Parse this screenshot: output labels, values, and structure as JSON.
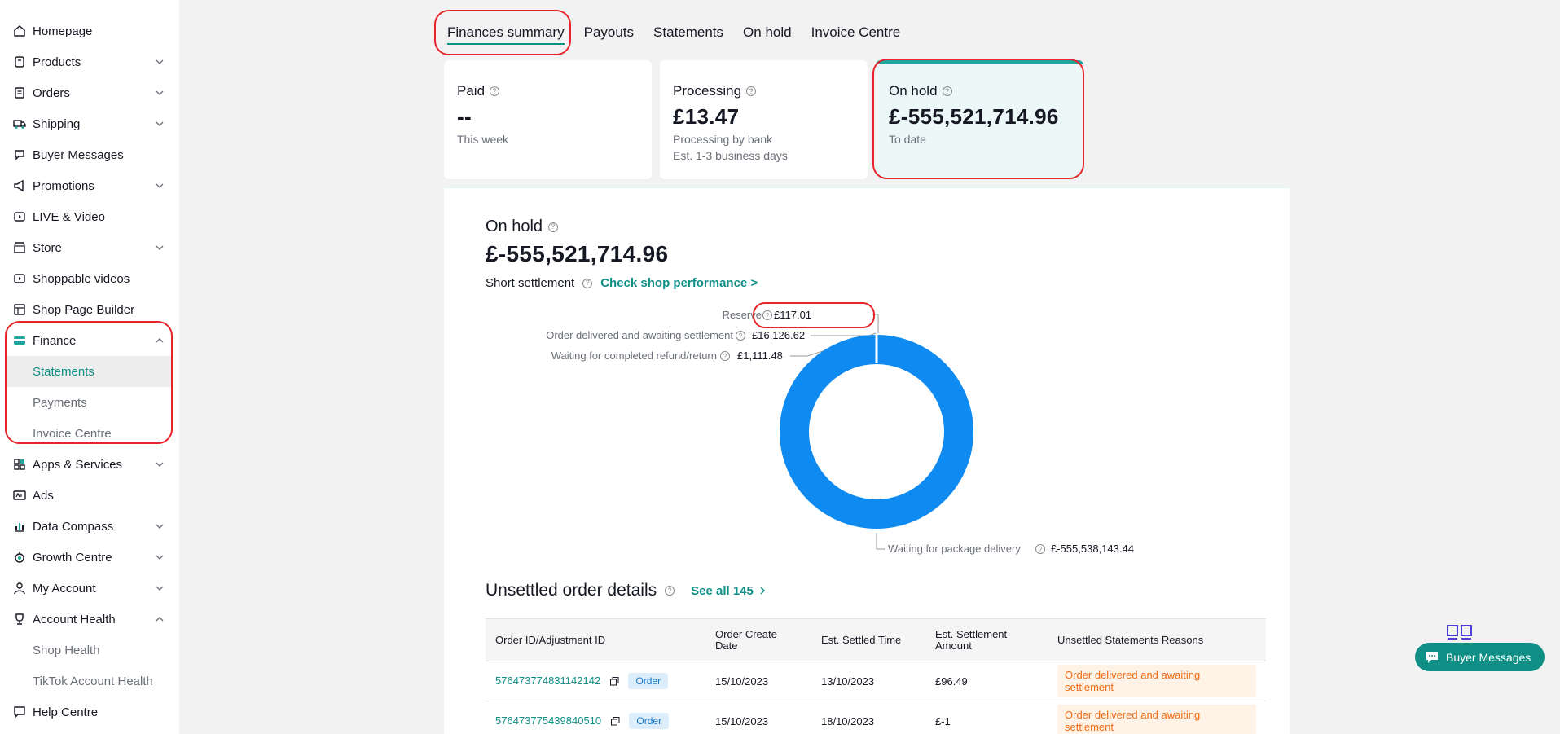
{
  "sidebar": {
    "items": [
      {
        "label": "Homepage",
        "icon": "home-icon",
        "chevron": false
      },
      {
        "label": "Products",
        "icon": "products-icon",
        "chevron": true
      },
      {
        "label": "Orders",
        "icon": "orders-icon",
        "chevron": true
      },
      {
        "label": "Shipping",
        "icon": "truck-icon",
        "chevron": true
      },
      {
        "label": "Buyer Messages",
        "icon": "chat-icon",
        "chevron": false
      },
      {
        "label": "Promotions",
        "icon": "megaphone-icon",
        "chevron": true
      },
      {
        "label": "LIVE & Video",
        "icon": "video-icon",
        "chevron": false
      },
      {
        "label": "Store",
        "icon": "store-icon",
        "chevron": true
      },
      {
        "label": "Shoppable videos",
        "icon": "video-icon",
        "chevron": false
      },
      {
        "label": "Shop Page Builder",
        "icon": "builder-icon",
        "chevron": false
      },
      {
        "label": "Finance",
        "icon": "card-icon",
        "chevron": "up"
      }
    ],
    "finance_sub": [
      "Statements",
      "Payments",
      "Invoice Centre"
    ],
    "items_after": [
      {
        "label": "Apps & Services",
        "icon": "apps-icon",
        "chevron": true
      },
      {
        "label": "Ads",
        "icon": "ads-icon",
        "chevron": false
      },
      {
        "label": "Data Compass",
        "icon": "chart-icon",
        "chevron": true
      },
      {
        "label": "Growth Centre",
        "icon": "growth-icon",
        "chevron": true
      },
      {
        "label": "My Account",
        "icon": "user-icon",
        "chevron": true
      },
      {
        "label": "Account Health",
        "icon": "trophy-icon",
        "chevron": "up"
      }
    ],
    "account_health_sub": [
      "Shop Health",
      "TikTok Account Health"
    ],
    "help": "Help Centre"
  },
  "tabs": [
    "Finances summary",
    "Payouts",
    "Statements",
    "On hold",
    "Invoice Centre"
  ],
  "cards": {
    "paid": {
      "label": "Paid",
      "value": "--",
      "sub": "This week"
    },
    "processing": {
      "label": "Processing",
      "value": "£13.47",
      "sub": "Processing by bank",
      "sub2": "Est. 1-3 business days"
    },
    "on_hold": {
      "label": "On hold",
      "value": "£-555,521,714.96",
      "sub": "To date"
    }
  },
  "main": {
    "title": "On hold",
    "amount": "£-555,521,714.96",
    "short_settlement": "Short settlement",
    "check_link": "Check shop performance >",
    "unsettled_title": "Unsettled order details",
    "see_all": "See all 145"
  },
  "chart_data": {
    "type": "pie",
    "donut": true,
    "slices": [
      {
        "label": "Reserve",
        "value_text": "£117.01"
      },
      {
        "label": "Order delivered and awaiting settlement",
        "value_text": "£16,126.62"
      },
      {
        "label": "Waiting for completed refund/return",
        "value_text": "£1,111.48"
      },
      {
        "label": "Waiting for package delivery",
        "value_text": "£-555,538,143.44"
      }
    ],
    "colors": {
      "main": "#0f8af0"
    }
  },
  "table": {
    "headers": [
      "Order ID/Adjustment ID",
      "Order Create Date",
      "Est. Settled Time",
      "Est. Settlement Amount",
      "Unsettled Statements Reasons"
    ],
    "rows": [
      {
        "id": "576473774831142142",
        "tag": "Order",
        "created": "15/10/2023",
        "settled": "13/10/2023",
        "amount": "£96.49",
        "reason": "Order delivered and awaiting settlement"
      },
      {
        "id": "576473775439840510",
        "tag": "Order",
        "created": "15/10/2023",
        "settled": "18/10/2023",
        "amount": "£-1",
        "reason": "Order delivered and awaiting settlement"
      }
    ]
  },
  "floating": {
    "buyer_messages": "Buyer Messages"
  },
  "colors": {
    "accent": "#0f8f86",
    "highlight": "#e8232a",
    "donut": "#0f8af0"
  }
}
